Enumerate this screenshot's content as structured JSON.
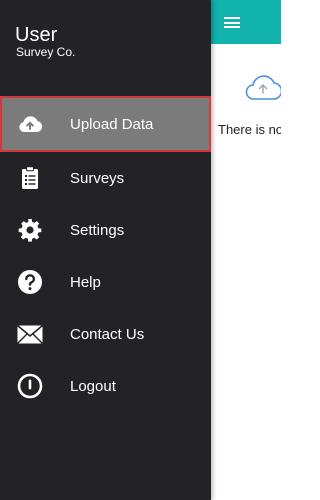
{
  "drawer": {
    "user_name": "User",
    "company": "Survey Co.",
    "items": [
      {
        "label": "Upload Data",
        "icon": "cloud-upload-icon",
        "selected": true
      },
      {
        "label": "Surveys",
        "icon": "clipboard-list-icon"
      },
      {
        "label": "Settings",
        "icon": "gear-icon"
      },
      {
        "label": "Help",
        "icon": "help-circle-icon"
      },
      {
        "label": "Contact Us",
        "icon": "mail-icon"
      },
      {
        "label": "Logout",
        "icon": "power-icon"
      }
    ]
  },
  "background": {
    "empty_message": "There is no",
    "appbar_color": "#12b3ad",
    "menu_icon": "hamburger-icon",
    "cloud_icon": "cloud-upload-outline-icon"
  },
  "colors": {
    "drawer_bg": "#232327",
    "selected_bg": "#7b7b7b",
    "selected_border": "#d2383c"
  }
}
